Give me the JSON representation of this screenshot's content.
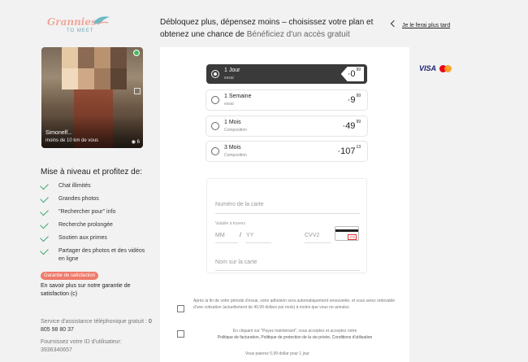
{
  "brand": {
    "logo_main": "Grannies",
    "logo_sub": "TO MEET"
  },
  "profile": {
    "name": "Simonelf...",
    "distance": "moins de 10 km de vous",
    "photo_count": "6"
  },
  "sidebar": {
    "upgrade_title": "Mise à niveau et profitez de:",
    "features": [
      "Chat illimités",
      "Grandes photos",
      "\"Rechercher pour\" info",
      "Recherche prolongée",
      "Soutien aux primes",
      "Partager des photos et des vidéos en ligne"
    ],
    "guarantee_badge": "Garantie de satisfaction",
    "guarantee_text": "En savoir plus sur notre garantie de satisfaction (c)",
    "support_label": "Service d'assistance téléphonique gratuit :",
    "support_phone": "0 805 98 80 37",
    "userid_label": "Fournissez votre ID d'utilisateur:",
    "userid": "3936340657"
  },
  "header": {
    "headline": "Débloquez plus, dépensez moins – choisissez votre plan et obtenez une chance de ",
    "headline_sub": "Bénéficiez d'un accès gratuit",
    "later": "Je le ferai plus tard"
  },
  "plans": [
    {
      "name": "1 Jour",
      "desc": "essai",
      "price": "0",
      "cents": "99",
      "selected": true
    },
    {
      "name": "1 Semaine",
      "desc": "essai",
      "price": "9",
      "cents": "99",
      "selected": false
    },
    {
      "name": "1 Mois",
      "desc": "Composition",
      "price": "49",
      "cents": "99",
      "selected": false
    },
    {
      "name": "3 Mois",
      "desc": "Composition",
      "price": "107",
      "cents": "13",
      "selected": false
    }
  ],
  "form": {
    "card_number": "Numéro de la carte",
    "valid_label": "Valable à travers",
    "mm": "MM",
    "slash": "/",
    "yy": "YY",
    "cvv": "CVV2",
    "cvv_code": "275",
    "name": "Nom sur la carte"
  },
  "legal": {
    "auto_renew": "Après la fin de votre période d'essai, votre adhésion sera automatiquement renouvelée, et vous serez redevable d'une cotisation (actuellement de 49,99 dollars par mois) à moins que vous ne annulez.",
    "terms_1": "En cliquant sur \"Payez maintenant\", vous acceptez et acceptez notre",
    "terms_2": "Politique de facturation, Politique de protection de la vie privée, Conditions d'utilisation",
    "footnote": "Vous paierez 0,99 dollar pour 1 jour"
  },
  "payment": {
    "visa": "VISA"
  },
  "colors": {
    "accent_green": "#3aa76d",
    "badge": "#ef7a6a",
    "selected_plan": "#3a3a3a"
  }
}
